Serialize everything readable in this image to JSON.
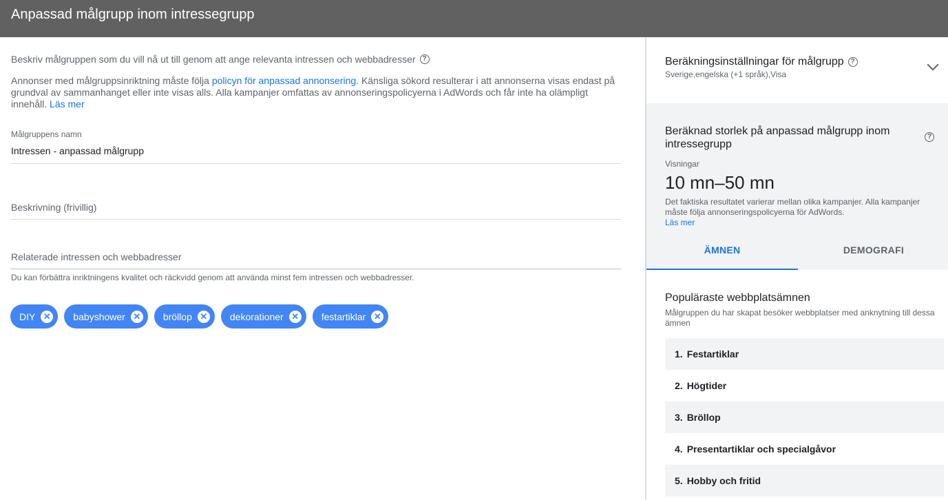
{
  "header": {
    "title": "Anpassad målgrupp inom intressegrupp"
  },
  "intro": {
    "text": "Beskriv målgruppen som du vill nå ut till genom att ange relevanta intressen och webbadresser",
    "help_icon": "help-circle-icon"
  },
  "policy": {
    "prefix": "Annonser med målgruppsinriktning måste följa ",
    "link": "policyn för anpassad annonsering",
    "suffix": ". Känsliga sökord resulterar i att annonserna visas endast på grundval av sammanhanget eller inte visas alls. Alla kampanjer omfattas av annonseringspolicyerna i AdWords och får inte ha olämpligt innehåll.",
    "read_more": "Läs mer"
  },
  "name_field": {
    "label": "Målgruppens namn",
    "value": "Intressen - anpassad målgrupp"
  },
  "description_field": {
    "placeholder": "Beskrivning (frivillig)"
  },
  "interests_field": {
    "placeholder": "Relaterade intressen och webbadresser",
    "hint": "Du kan förbättra inriktningens kvalitet och räckvidd genom att använda minst fem intressen och webbadresser."
  },
  "chips": [
    {
      "label": "DIY"
    },
    {
      "label": "babyshower"
    },
    {
      "label": "bröllop"
    },
    {
      "label": "dekorationer"
    },
    {
      "label": "festartiklar"
    }
  ],
  "settings": {
    "title": "Beräkningsinställningar för målgrupp",
    "subtitle": "Sverige,engelska (+1 språk),Visa"
  },
  "estimate": {
    "title": "Beräknad storlek på anpassad målgrupp inom intressegrupp",
    "label": "Visningar",
    "value": "10 mn–50 mn",
    "note": "Det faktiska resultatet varierar mellan olika kampanjer. Alla kampanjer måste följa annonseringspolicyerna för AdWords.",
    "read_more": "Läs mer"
  },
  "tabs": [
    {
      "label": "ÄMNEN"
    },
    {
      "label": "DEMOGRAFI"
    }
  ],
  "topics": {
    "title": "Populäraste webbplatsämnen",
    "subtitle": "Målgruppen du har skapat besöker webbplatser med anknytning till dessa ämnen",
    "items": [
      {
        "num": "1.",
        "label": "Festartiklar"
      },
      {
        "num": "2.",
        "label": "Högtider"
      },
      {
        "num": "3.",
        "label": "Bröllop"
      },
      {
        "num": "4.",
        "label": "Presentartiklar och specialgåvor"
      },
      {
        "num": "5.",
        "label": "Hobby och fritid"
      }
    ]
  },
  "colors": {
    "accent": "#1a73e8",
    "chip": "#4285f4",
    "header": "#616161"
  }
}
